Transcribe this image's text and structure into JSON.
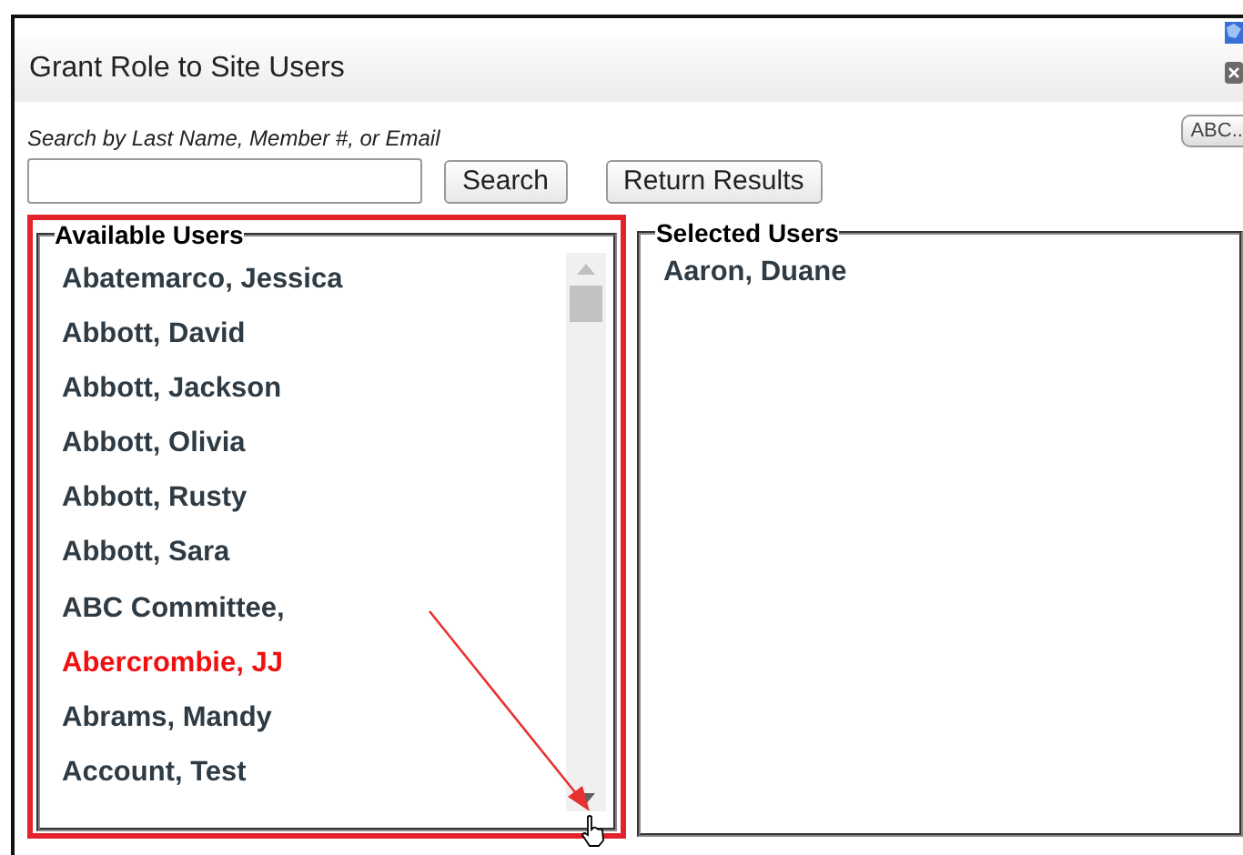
{
  "dialog": {
    "title": "Grant Role to Site Users"
  },
  "search": {
    "label": "Search by Last Name, Member #, or Email",
    "search_button": "Search",
    "return_button": "Return Results",
    "abc_button": "ABC..."
  },
  "available_users": {
    "legend": "Available Users",
    "highlighted": true,
    "items": [
      {
        "name": "Abatemarco, Jessica",
        "selected": false
      },
      {
        "name": "Abbott, David",
        "selected": false
      },
      {
        "name": "Abbott, Jackson",
        "selected": false
      },
      {
        "name": "Abbott, Olivia",
        "selected": false
      },
      {
        "name": "Abbott, Rusty",
        "selected": false
      },
      {
        "name": "Abbott, Sara",
        "selected": false
      },
      {
        "name": "ABC Committee,",
        "selected": false
      },
      {
        "name": "Abercrombie, JJ",
        "selected": true
      },
      {
        "name": "Abrams, Mandy",
        "selected": false
      },
      {
        "name": "Account, Test",
        "selected": false
      }
    ]
  },
  "selected_users": {
    "legend": "Selected Users",
    "items": [
      {
        "name": "Aaron, Duane"
      }
    ]
  }
}
